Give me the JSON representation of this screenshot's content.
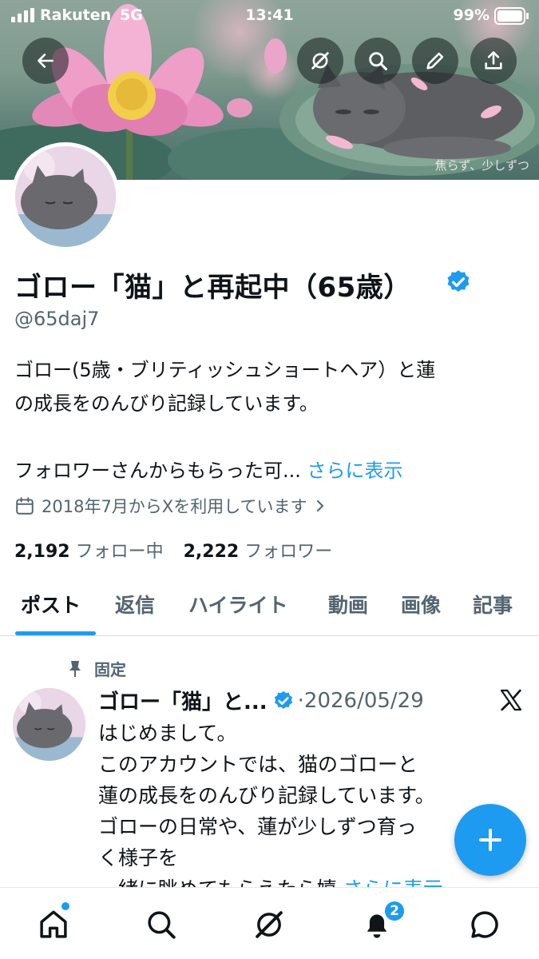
{
  "status_bar": {
    "carrier": "Rakuten",
    "network": "5G",
    "time": "13:41",
    "battery": "99%"
  },
  "banner": {
    "caption": "焦らず、少しずつ"
  },
  "profile": {
    "name": "ゴロー「猫」と再起中（65歳）",
    "handle": "@65daj7",
    "bio_line1": "ゴロー(5歳・ブリティッシュショートヘア）と蓮",
    "bio_line2": "の成長をのんびり記録しています。",
    "bio_line3": "フォロワーさんからもらった可...",
    "bio_more": "さらに表示",
    "joined": "2018年7月からXを利用しています",
    "following_count": "2,192",
    "following_label": "フォロー中",
    "followers_count": "2,222",
    "followers_label": "フォロワー"
  },
  "tabs": [
    "ポスト",
    "返信",
    "ハイライト",
    "動画",
    "画像",
    "記事"
  ],
  "pinned_tweet": {
    "pinned_label": "固定",
    "author": "ゴロー「猫」と...",
    "date": "·2026/05/29",
    "lines": [
      "はじめまして。",
      "このアカウントでは、猫のゴローと",
      "蓮の成長をのんびり記録しています。",
      "ゴローの日常や、蓮が少しずつ育っ",
      "く様子を",
      "一緒に眺めてもらえたら嬉"
    ],
    "more": "さらに表示"
  },
  "bottom_nav": {
    "items": [
      "home-icon",
      "search-icon",
      "grok-icon",
      "notifications-icon",
      "messages-icon"
    ],
    "notification_badge": "2"
  },
  "colors": {
    "accent": "#1d9bf0",
    "text": "#0f1419",
    "secondary": "#536471"
  }
}
